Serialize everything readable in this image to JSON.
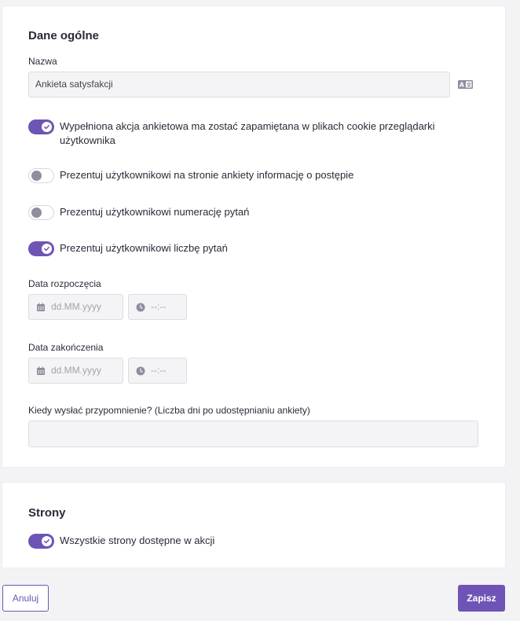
{
  "general": {
    "title": "Dane ogólne",
    "name_label": "Nazwa",
    "name_value": "Ankieta satysfakcji",
    "toggles": [
      {
        "label": "Wypełniona akcja ankietowa ma zostać zapamiętana w plikach cookie przeglądarki użytkownika",
        "on": true
      },
      {
        "label": "Prezentuj użytkownikowi na stronie ankiety informację o postępie",
        "on": false
      },
      {
        "label": "Prezentuj użytkownikowi numerację pytań",
        "on": false
      },
      {
        "label": "Prezentuj użytkownikowi liczbę pytań",
        "on": true
      }
    ],
    "start_date_label": "Data rozpoczęcia",
    "end_date_label": "Data zakończenia",
    "date_placeholder": "dd.MM.yyyy",
    "time_placeholder": "--:--",
    "reminder_label": "Kiedy wysłać przypomnienie? (Liczba dni po udostępnianiu ankiety)",
    "reminder_value": ""
  },
  "pages": {
    "title": "Strony",
    "toggle_label": "Wszystkie strony dostępne w akcji",
    "toggle_on": true
  },
  "actions": {
    "cancel_label": "Anuluj",
    "save_label": "Zapisz"
  },
  "colors": {
    "accent": "#6e54b5",
    "background": "#f3f3f6",
    "card": "#ffffff"
  },
  "icons": {
    "translate": "translate-icon",
    "check": "check-icon",
    "calendar": "calendar-icon",
    "clock": "clock-icon"
  }
}
